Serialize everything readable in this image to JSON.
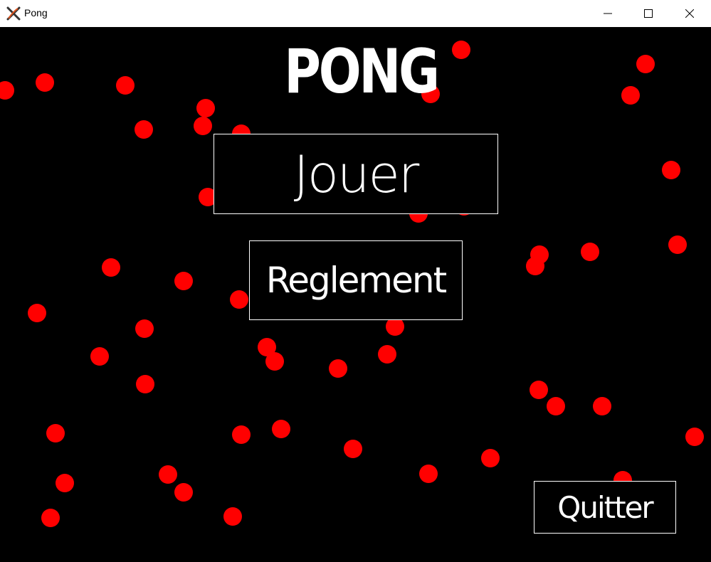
{
  "window": {
    "title": "Pong",
    "app_icon": "x-app-icon",
    "controls": [
      "minimize-icon",
      "maximize-icon",
      "close-icon"
    ]
  },
  "game": {
    "title": "PONG",
    "buttons": {
      "play": "Jouer",
      "rules": "Reglement",
      "quit": "Quitter"
    },
    "ball_color": "#ff0000",
    "background_color": "#000000",
    "text_color": "#ffffff"
  }
}
